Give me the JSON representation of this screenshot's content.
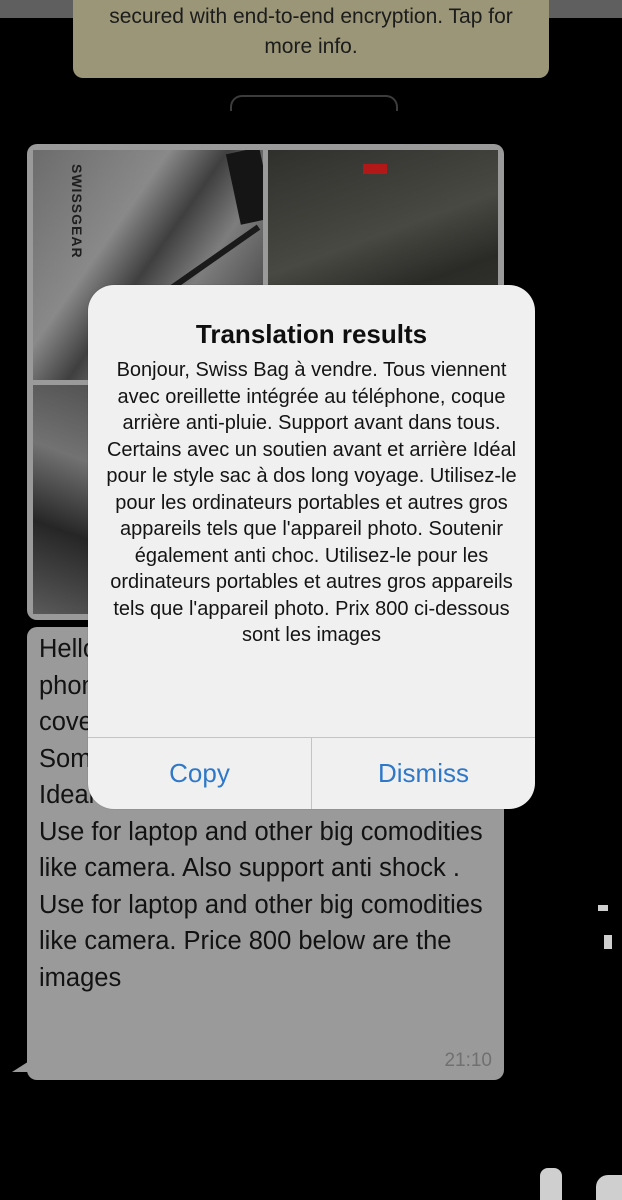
{
  "encryption_notice": {
    "text": "secured with end-to-end encryption. Tap for more info."
  },
  "photos": {
    "brand_label": "SWISSGEAR"
  },
  "message": {
    "text": "Hello, Swiss Bag for sale. All come with phone built in earphone, back rain cover.\nSome with front and back support in all.\nIdeal for long voyage back pack style. Use for laptop and other big comodities like camera. Also support anti shock . Use for laptop and other big comodities like camera. Price 800 below are the images",
    "time": "21:10"
  },
  "translation_dialog": {
    "title": "Translation results",
    "body": "Bonjour, Swiss Bag à vendre. Tous viennent avec oreillette intégrée au téléphone, coque arrière anti-pluie. Support avant dans tous. Certains avec un soutien avant et arrière Idéal pour le style sac à dos long voyage. Utilisez-le pour les ordinateurs portables et autres gros appareils tels que l'appareil photo. Soutenir également anti choc. Utilisez-le pour les ordinateurs portables et autres gros appareils tels que l'appareil photo. Prix 800 ci-dessous sont les images",
    "copy_label": "Copy",
    "dismiss_label": "Dismiss",
    "accent_color": "#2f78c8"
  }
}
